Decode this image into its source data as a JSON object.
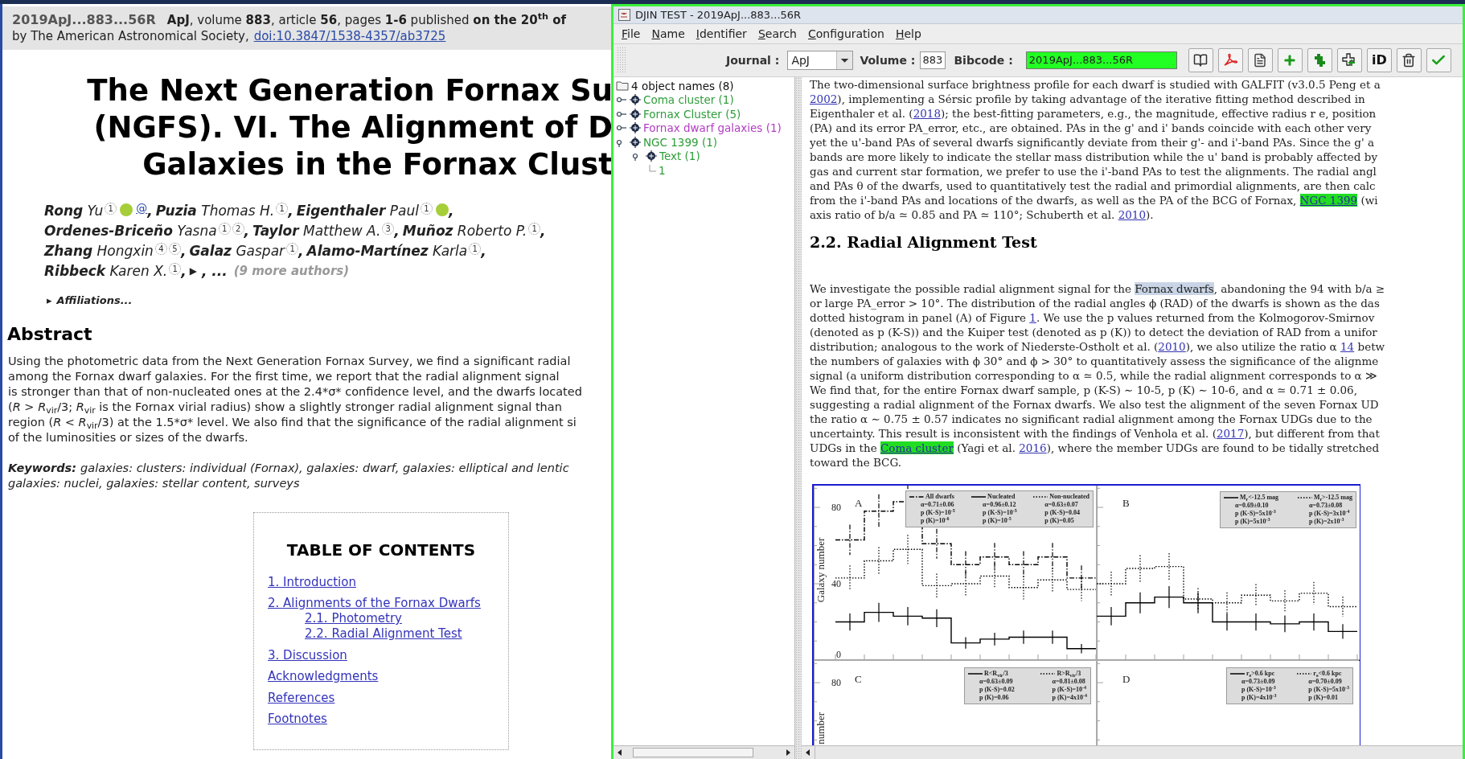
{
  "article": {
    "bibcode": "2019ApJ...883...56R",
    "citation": "**ApJ**, volume **883**, article **56**, pages **1-6** published **on the 20$^{th}$ of**",
    "publisher": "by The American Astronomical Society,",
    "doi": "doi:10.3847/1538-4357/ab3725",
    "title_lines": [
      "The Next Generation Fornax Su",
      "(NGFS). VI. The Alignment of D",
      "Galaxies in the Fornax Clust"
    ],
    "author_lines": [
      [
        {
          "name": "**Rong** Yu",
          "affiliations": [
            "1"
          ],
          "orcid": true,
          "email": "@",
          "sep": ","
        },
        {
          "name": "**Puzia** Thomas H.",
          "affiliations": [
            "1"
          ],
          "orcid": false,
          "sep": ","
        },
        {
          "name": "**Eigenthaler** Paul",
          "affiliations": [
            "1"
          ],
          "orcid": true,
          "sep": ","
        }
      ],
      [
        {
          "name": "**Ordenes-Briceño** Yasna",
          "affiliations": [
            "1",
            "2"
          ],
          "orcid": false,
          "sep": ","
        },
        {
          "name": "**Taylor** Matthew A.",
          "affiliations": [
            "3"
          ],
          "orcid": false,
          "sep": ","
        },
        {
          "name": "**Muñoz** Roberto P.",
          "affiliations": [
            "1"
          ],
          "orcid": false,
          "sep": ","
        }
      ],
      [
        {
          "name": "**Zhang** Hongxin",
          "affiliations": [
            "4",
            "5"
          ],
          "orcid": false,
          "sep": ","
        },
        {
          "name": "**Galaz** Gaspar",
          "affiliations": [
            "1"
          ],
          "orcid": false,
          "sep": ","
        },
        {
          "name": "**Alamo-Martínez** Karla",
          "affiliations": [
            "1"
          ],
          "orcid": false,
          "sep": ","
        }
      ],
      [
        {
          "name": "**Ribbeck** Karen X.",
          "affiliations": [
            "1"
          ],
          "orcid": false,
          "sep": ","
        }
      ]
    ],
    "more_authors": {
      "arrow": "▶",
      "ellipsis": ", ...",
      "label": "(9 more authors)"
    },
    "affiliations": {
      "arrow": "▸",
      "label": "Affiliations...",
      "expanded": false
    },
    "abstract": {
      "heading": "Abstract",
      "lines": [
        "Using the photometric data from the Next Generation Fornax Survey, we find a significant radial",
        "among the Fornax dwarf galaxies. For the first time, we report that the radial alignment signal",
        "is stronger than that of non-nucleated ones at the 2.4*σ* confidence level, and the dwarfs located",
        "(*R* > *R*$_{vir}$/3; *R*$_{vir}$ is the Fornax virial radius) show a slightly stronger radial alignment signal than",
        "region (*R* < *R*$_{vir}$/3) at the 1.5*σ* level. We also find that the significance of the radial alignment si",
        "of the luminosities or sizes of the dwarfs."
      ]
    },
    "keywords": {
      "label": "Keywords:",
      "lines": [
        "galaxies: clusters: individual (Fornax), galaxies: dwarf, galaxies: elliptical and lentic",
        "galaxies: nuclei, galaxies: stellar content, surveys"
      ]
    },
    "toc": {
      "heading": "TABLE OF CONTENTS",
      "items": [
        {
          "label": "1. Introduction"
        },
        {
          "label": "2. Alignments of the Fornax Dwarfs",
          "children": [
            {
              "label": "2.1. Photometry"
            },
            {
              "label": "2.2. Radial Alignment Test"
            }
          ]
        },
        {
          "label": "3. Discussion"
        },
        {
          "label": "Acknowledgments"
        },
        {
          "label": "References"
        },
        {
          "label": "Footnotes"
        }
      ]
    }
  },
  "window": {
    "title": "DJIN TEST - 2019ApJ...883...56R",
    "menu": [
      "File",
      "Name",
      "Identifier",
      "Search",
      "Configuration",
      "Help"
    ],
    "toolbar": {
      "journal": {
        "label": "Journal :",
        "value": "ApJ"
      },
      "volume": {
        "label": "Volume :",
        "value": "883"
      },
      "bibcode": {
        "label": "Bibcode :",
        "value": "2019ApJ...883...56R"
      },
      "buttons": [
        {
          "kind": "book"
        },
        {
          "kind": "pdf"
        },
        {
          "kind": "document"
        },
        {
          "kind": "add"
        },
        {
          "kind": "add_multiple"
        },
        {
          "kind": "add_outline"
        },
        {
          "kind": "orcid",
          "label": "iD"
        },
        {
          "kind": "delete"
        },
        {
          "kind": "confirm"
        }
      ]
    }
  },
  "tree": {
    "kind": "folder",
    "label": "4 object names (8)",
    "children": [
      {
        "kind": "node",
        "label": "Coma cluster (1)",
        "color": "#2e9e3a",
        "expanded": false
      },
      {
        "kind": "node",
        "label": "Fornax Cluster (5)",
        "color": "#2e9e3a",
        "expanded": false
      },
      {
        "kind": "node",
        "label": "Fornax dwarf galaxies (1)",
        "color": "#b33cc4",
        "expanded": false
      },
      {
        "kind": "node",
        "label": "NGC 1399 (1)",
        "color": "#2e9e3a",
        "expanded": true,
        "children": [
          {
            "kind": "node",
            "label": "Text (1)",
            "color": "#2e9e3a",
            "expanded": true,
            "children": [
              {
                "kind": "leaf",
                "label": "1",
                "color": "#2e9e3a"
              }
            ]
          }
        ]
      }
    ]
  },
  "document": {
    "blocks": [
      {
        "kind": "paragraph",
        "lines": [
          [
            {
              "kind": "text",
              "t": "The two-dimensional surface brightness profile for each dwarf is studied with GALFIT (v3.0.5 Peng et a"
            }
          ],
          [
            {
              "kind": "link",
              "t": "2002"
            },
            {
              "kind": "text",
              "t": "), implementing a Sérsic profile by taking advantage of the iterative fitting method described in"
            }
          ],
          [
            {
              "kind": "text",
              "t": "Eigenthaler et al. ("
            },
            {
              "kind": "link",
              "t": "2018"
            },
            {
              "kind": "text",
              "t": "); the best-fitting parameters, e.g., the magnitude, effective radius r e, position"
            }
          ],
          [
            {
              "kind": "text",
              "t": "(PA) and its error PA_error, etc., are obtained. PAs in the g' and i' bands coincide with each other very"
            }
          ],
          [
            {
              "kind": "text",
              "t": "yet the u'-band PAs of several dwarfs significantly deviate from their g'- and i'-band PAs. Since the g' a"
            }
          ],
          [
            {
              "kind": "text",
              "t": "bands are more likely to indicate the stellar mass distribution while the u' band is probably affected by"
            }
          ],
          [
            {
              "kind": "text",
              "t": "gas and current star formation, we prefer to use the i'-band PAs to test the alignments. The radial angl"
            }
          ],
          [
            {
              "kind": "text",
              "t": "and PAs θ of the dwarfs, used to quantitatively test the radial and primordial alignments, are then calc"
            }
          ],
          [
            {
              "kind": "text",
              "t": "from the i'-band PAs and locations of the dwarfs, as well as the PA of the BCG of Fornax, "
            },
            {
              "kind": "highlight",
              "t": "NGC 1399"
            },
            {
              "kind": "text",
              "t": " (wi"
            }
          ],
          [
            {
              "kind": "text",
              "t": "axis ratio of b/a ≃ 0.85 and PA ≃ 110°; Schuberth et al. "
            },
            {
              "kind": "link",
              "t": "2010"
            },
            {
              "kind": "text",
              "t": ")."
            }
          ]
        ]
      },
      {
        "kind": "heading",
        "text": "2.2. Radial Alignment Test"
      },
      {
        "kind": "paragraph",
        "lines": [
          [
            {
              "kind": "text",
              "t": "We investigate the possible radial alignment signal for the "
            },
            {
              "kind": "selection",
              "t": "Fornax dwarfs"
            },
            {
              "kind": "text",
              "t": ", abandoning the 94 with b/a ≥"
            }
          ],
          [
            {
              "kind": "text",
              "t": "or large PA_error > 10°. The distribution of the radial angles ϕ (RAD) of the dwarfs is shown as the das"
            }
          ],
          [
            {
              "kind": "text",
              "t": "dotted histogram in panel (A) of Figure "
            },
            {
              "kind": "link",
              "t": "1"
            },
            {
              "kind": "text",
              "t": ". We use the p values returned from the Kolmogorov-Smirnov"
            }
          ],
          [
            {
              "kind": "text",
              "t": "(denoted as p (K-S)) and the Kuiper test (denoted as p (K)) to detect the deviation of RAD from a unifor"
            }
          ],
          [
            {
              "kind": "text",
              "t": "distribution; analogous to the work of Niederste-Ostholt et al. ("
            },
            {
              "kind": "link",
              "t": "2010"
            },
            {
              "kind": "text",
              "t": "), we also utilize the ratio α "
            },
            {
              "kind": "link",
              "t": "14"
            },
            {
              "kind": "text",
              "t": " betw"
            }
          ],
          [
            {
              "kind": "text",
              "t": "the numbers of galaxies with ϕ 30° and ϕ > 30° to quantitatively assess the significance of the alignme"
            }
          ],
          [
            {
              "kind": "text",
              "t": "signal (a uniform distribution corresponding to α ≃ 0.5, while the radial alignment corresponds to α ≫"
            }
          ],
          [
            {
              "kind": "text",
              "t": "We find that, for the entire Fornax dwarf sample, p (K-S) ∼ 10-5, p (K) ∼ 10-6, and α ≃ 0.71 ± 0.06,"
            }
          ],
          [
            {
              "kind": "text",
              "t": "suggesting a radial alignment of the Fornax dwarfs. We also test the alignment of the seven Fornax UD"
            }
          ],
          [
            {
              "kind": "text",
              "t": "the ratio α ∼ 0.75 ± 0.57 indicates no significant radial alignment among the Fornax UDGs due to the"
            }
          ],
          [
            {
              "kind": "text",
              "t": "uncertainty. This result is inconsistent with the findings of Venhola et al. ("
            },
            {
              "kind": "link",
              "t": "2017"
            },
            {
              "kind": "text",
              "t": "), but different from that"
            }
          ],
          [
            {
              "kind": "text",
              "t": "UDGs in the "
            },
            {
              "kind": "highlight",
              "t": "Coma cluster"
            },
            {
              "kind": "text",
              "t": " (Yagi et al. "
            },
            {
              "kind": "link",
              "t": "2016"
            },
            {
              "kind": "text",
              "t": "), where the member UDGs are found to be tidally stretched"
            }
          ],
          [
            {
              "kind": "text",
              "t": "toward the BCG."
            }
          ]
        ]
      }
    ],
    "figure": {
      "panels": [
        {
          "letter": "A",
          "kind": "picture",
          "ylabel": "Galaxy number",
          "yticks": [
            "80",
            "40",
            "0"
          ],
          "legend": [
            {
              "name": "All dwarfs",
              "lines": [
                "α=0.71±0.06",
                "p (K-S)=10$^{-5}$",
                "p (K)=10$^{-6}$"
              ]
            },
            {
              "name": "Nucleated",
              "lines": [
                "α=0.96±0.12",
                "p (K-S)=10$^{-5}$",
                "p (K)=10$^{-5}$"
              ]
            },
            {
              "name": "Non-nucleated",
              "lines": [
                "α=0.63±0.07",
                "p (K-S)=0.04",
                "p (K)=0.05"
              ]
            }
          ]
        },
        {
          "letter": "B",
          "kind": "picture",
          "legend": [
            {
              "name": "M$_{r}$<-12.5 mag",
              "lines": [
                "α=0.69±0.10",
                "p (K-S)=5x10$^{-3}$",
                "p (K)=5x10$^{-3}$"
              ]
            },
            {
              "name": "M$_{r}$>-12.5 mag",
              "lines": [
                "α=0.73±0.08",
                "p (K-S)=3x10$^{-4}$",
                "p (K)=2x10$^{-3}$"
              ]
            }
          ]
        },
        {
          "letter": "C",
          "ylabel": "number",
          "yticks": [
            "80"
          ],
          "legend": [
            {
              "name": "R<R$_{vir}$/3",
              "lines": [
                "α=0.63±0.09",
                "p (K-S)=0.02",
                "p (K)=0.06"
              ]
            },
            {
              "name": "R>R$_{vir}$/3",
              "lines": [
                "α=0.81±0.08",
                "p (K-S)=10$^{-4}$",
                "p (K)=4x10$^{-4}$"
              ]
            }
          ]
        },
        {
          "letter": "D",
          "legend": [
            {
              "name": "r$_{e}$>0.6 kpc",
              "lines": [
                "α=0.73±0.09",
                "p (K-S)=10$^{-3}$",
                "p (K)=4x10$^{-3}$"
              ]
            },
            {
              "name": "r$_{e}$<0.6 kpc",
              "lines": [
                "α=0.70±0.09",
                "p (K-S)=5x10$^{-3}$",
                "p (K)=0.01"
              ]
            }
          ]
        }
      ]
    }
  }
}
